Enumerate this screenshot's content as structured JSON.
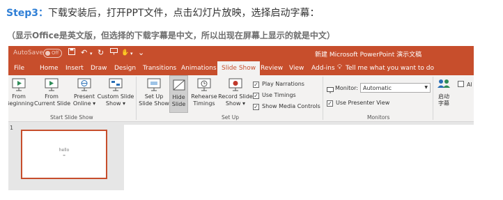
{
  "header": {
    "step_label": "Step3",
    "step_sep": "：",
    "step_text": "下载安装后，打开PPT文件，点击幻灯片放映，选择启动字幕：",
    "note": "（显示Office是英文版，但选择的下载字幕是中文，所以出现在屏幕上显示的就是中文）"
  },
  "titlebar": {
    "autosave": "AutoSave",
    "toggle": "Off",
    "window_title": "新建 Microsoft PowerPoint 演示文稿"
  },
  "tabs": [
    "File",
    "Home",
    "Insert",
    "Draw",
    "Design",
    "Transitions",
    "Animations",
    "Slide Show",
    "Review",
    "View",
    "Add-ins"
  ],
  "active_tab": "Slide Show",
  "tell_me": "Tell me what you want to do",
  "ribbon": {
    "start_group": {
      "label": "Start Slide Show",
      "from_beginning": [
        "From",
        "Beginning"
      ],
      "from_current": [
        "From",
        "Current Slide"
      ],
      "present_online": [
        "Present",
        "Online ▾"
      ],
      "custom_show": [
        "Custom Slide",
        "Show ▾"
      ]
    },
    "setup_group": {
      "label": "Set Up",
      "setup_show": [
        "Set Up",
        "Slide Show"
      ],
      "hide_slide": [
        "Hide",
        "Slide"
      ],
      "rehearse": [
        "Rehearse",
        "Timings"
      ],
      "record": [
        "Record Slide",
        "Show ▾"
      ],
      "play_narrations": "Play Narrations",
      "use_timings": "Use Timings",
      "show_media_controls": "Show Media Controls"
    },
    "monitors_group": {
      "label": "Monitors",
      "monitor_label": "Monitor:",
      "monitor_value": "Automatic",
      "use_presenter_view": "Use Presenter View"
    },
    "subtitles": [
      "启动",
      "字幕"
    ],
    "always_use": "Al"
  },
  "slides": {
    "number": "1",
    "thumb_text": "hello"
  },
  "colors": {
    "accent": "#c74e2c",
    "step_blue": "#2f7fd6"
  }
}
